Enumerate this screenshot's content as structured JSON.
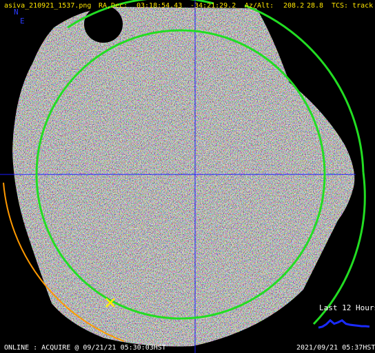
{
  "header": {
    "filename": "asiva_210921_1537.png",
    "radec_label": "RA,Dec:",
    "ra": "03:18:54.43",
    "dec": "-34:21:29.2",
    "azalt_label": "Az/Alt:",
    "az": "208.2",
    "alt": "28.8",
    "tcs": "TCS: track"
  },
  "compass": {
    "north": "N",
    "east": "E"
  },
  "trend": {
    "label": "Last 12 Hours",
    "color": "#1a2bff",
    "values": [
      0.2,
      0.3,
      0.55,
      0.95,
      0.6,
      0.75,
      0.95,
      0.6,
      0.5,
      0.45,
      0.4,
      0.35,
      0.35,
      0.3
    ]
  },
  "status": {
    "left": "ONLINE : ACQUIRE @ 09/21/21 05:30:03HST",
    "right": "2021/09/21 05:37HST"
  },
  "overlay": {
    "crosshair_color": "#1a1aff",
    "circle_color": "#22dd22",
    "arc_color": "#ff9900",
    "marker_color": "#ffee00"
  }
}
